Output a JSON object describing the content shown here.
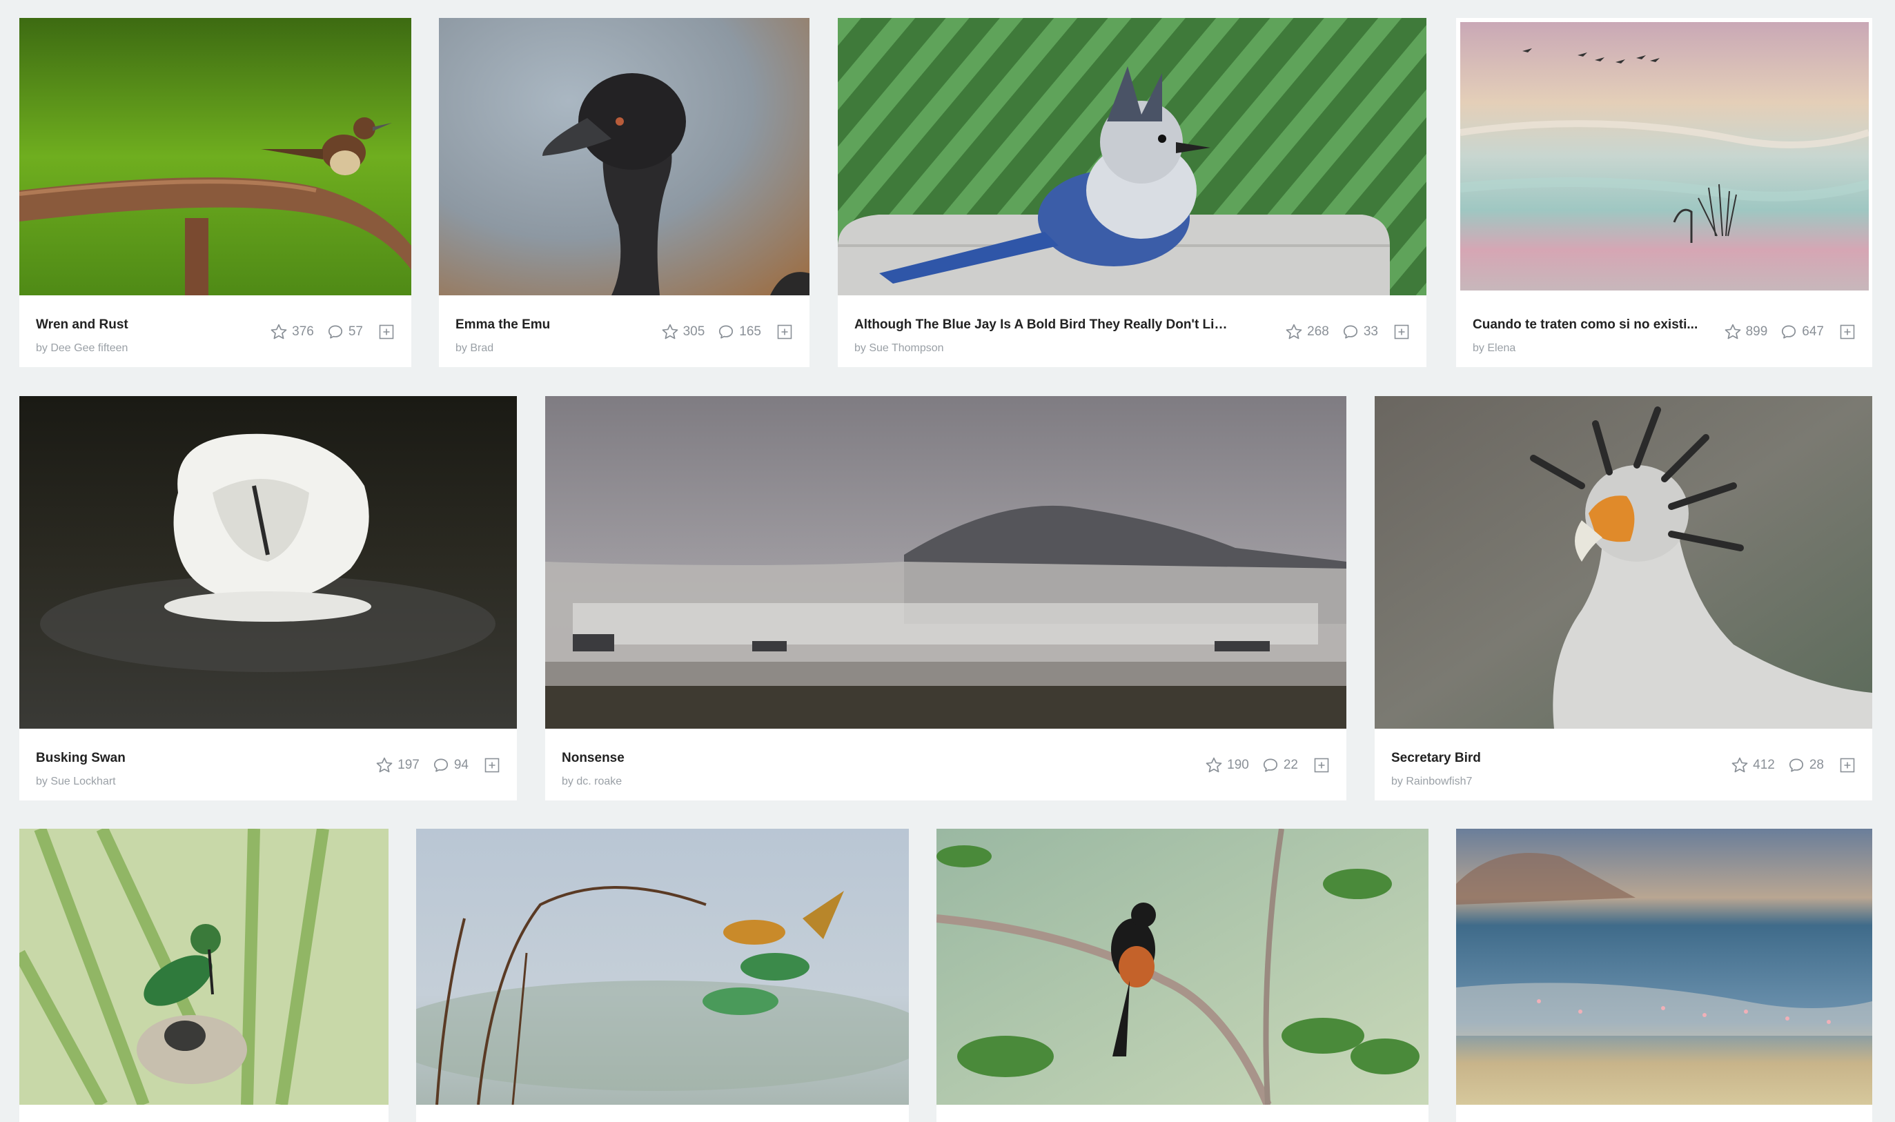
{
  "rows": [
    {
      "cards": [
        {
          "title": "Wren and Rust",
          "author": "by Dee Gee fifteen",
          "likes": "376",
          "comments": "57"
        },
        {
          "title": "Emma the Emu",
          "author": "by Brad",
          "likes": "305",
          "comments": "165"
        },
        {
          "title": "Although The Blue Jay Is A Bold Bird They Really Don't Like T...",
          "author": "by Sue Thompson",
          "likes": "268",
          "comments": "33"
        },
        {
          "title": "Cuando te traten como si no existi...",
          "author": "by Elena",
          "likes": "899",
          "comments": "647"
        }
      ]
    },
    {
      "cards": [
        {
          "title": "Busking Swan",
          "author": "by Sue Lockhart",
          "likes": "197",
          "comments": "94"
        },
        {
          "title": "Nonsense",
          "author": "by dc. roake",
          "likes": "190",
          "comments": "22"
        },
        {
          "title": "Secretary Bird",
          "author": "by Rainbowfish7",
          "likes": "412",
          "comments": "28"
        }
      ]
    }
  ],
  "photos": [
    {
      "subject": "wren"
    },
    {
      "subject": "emu"
    },
    {
      "subject": "blue-jay"
    },
    {
      "subject": "flamingo"
    },
    {
      "subject": "swan"
    },
    {
      "subject": "snow-geese"
    },
    {
      "subject": "secretary-bird"
    },
    {
      "subject": "hummingbird"
    },
    {
      "subject": "bee-eaters"
    },
    {
      "subject": "shama"
    },
    {
      "subject": "lagoon"
    }
  ],
  "icons": {
    "like": "star-icon",
    "comment": "comment-icon",
    "add": "add-to-gallery-icon"
  },
  "colors": {
    "background": "#eef1f2",
    "card": "#ffffff",
    "title": "#222222",
    "meta": "#9aa0a6"
  }
}
